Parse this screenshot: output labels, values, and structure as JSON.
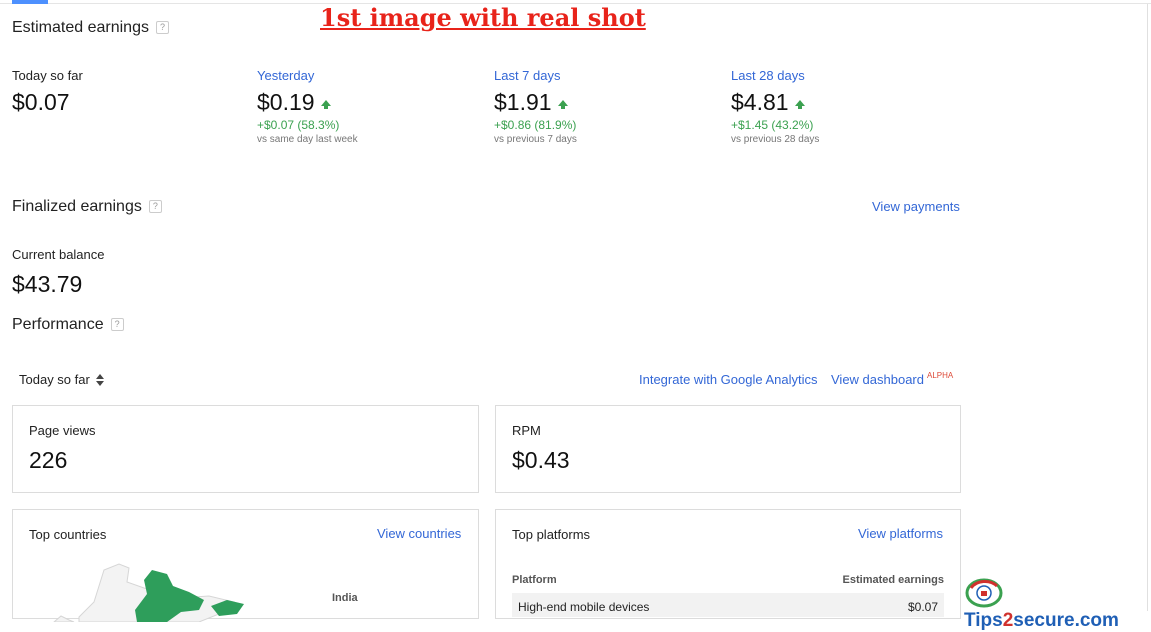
{
  "banner": "1st image with real shot",
  "estimated": {
    "title": "Estimated earnings",
    "help": "?",
    "today": {
      "label": "Today so far",
      "value": "$0.07"
    },
    "yesterday": {
      "label": "Yesterday",
      "value": "$0.19",
      "delta": "+$0.07 (58.3%)",
      "compare": "vs same day last week"
    },
    "last7": {
      "label": "Last 7 days",
      "value": "$1.91",
      "delta": "+$0.86 (81.9%)",
      "compare": "vs previous 7 days"
    },
    "last28": {
      "label": "Last 28 days",
      "value": "$4.81",
      "delta": "+$1.45 (43.2%)",
      "compare": "vs previous 28 days"
    }
  },
  "finalized": {
    "title": "Finalized earnings",
    "help": "?",
    "view_payments": "View payments",
    "balance_label": "Current balance",
    "balance_value": "$43.79"
  },
  "performance": {
    "title": "Performance",
    "help": "?",
    "range_select": "Today so far",
    "integrate_link": "Integrate with Google Analytics",
    "dashboard_link": "View dashboard",
    "dashboard_badge": "ALPHA",
    "page_views": {
      "label": "Page views",
      "value": "226"
    },
    "rpm": {
      "label": "RPM",
      "value": "$0.43"
    }
  },
  "countries": {
    "title": "Top countries",
    "view_link": "View countries",
    "map_label": "India",
    "map_color": "#2e9e5b"
  },
  "platforms": {
    "title": "Top platforms",
    "view_link": "View platforms",
    "col_platform": "Platform",
    "col_earnings": "Estimated earnings",
    "rows": [
      {
        "platform": "High-end mobile devices",
        "earnings": "$0.07"
      }
    ]
  },
  "watermark": {
    "prefix": "Tips",
    "two": "2",
    "suffix": "secure.com"
  },
  "colors": {
    "accent": "#3367d6",
    "positive": "#3ba150",
    "banner": "#e8231a"
  }
}
